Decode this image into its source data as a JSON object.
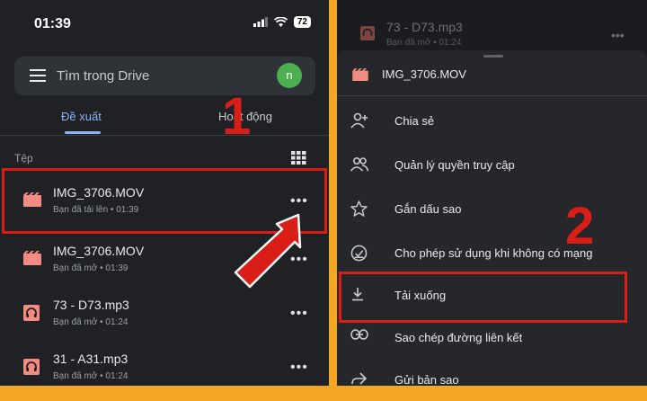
{
  "status_bar": {
    "time": "01:39",
    "battery": "72"
  },
  "search": {
    "placeholder": "Tìm trong Drive",
    "avatar_letter": "n"
  },
  "tabs": [
    {
      "label": "Đề xuất"
    },
    {
      "label": "Hoạt động"
    }
  ],
  "section_label": "Tệp",
  "files": [
    {
      "name": "IMG_3706.MOV",
      "meta": "Bạn đã tải lên • 01:39",
      "icon": "video-icon"
    },
    {
      "name": "IMG_3706.MOV",
      "meta": "Bạn đã mở • 01:39",
      "icon": "video-icon"
    },
    {
      "name": "73 - D73.mp3",
      "meta": "Bạn đã mở • 01:24",
      "icon": "audio-icon"
    },
    {
      "name": "31 - A31.mp3",
      "meta": "Bạn đã mở • 01:24",
      "icon": "audio-icon"
    }
  ],
  "right_top_file": {
    "name": "73 - D73.mp3",
    "meta": "Bạn đã mở • 01:24"
  },
  "sheet": {
    "title": "IMG_3706.MOV",
    "items": [
      {
        "label": "Chia sẻ",
        "icon": "person-add-icon"
      },
      {
        "label": "Quản lý quyền truy cập",
        "icon": "people-icon"
      },
      {
        "label": "Gắn dấu sao",
        "icon": "star-icon"
      },
      {
        "label": "Cho phép sử dụng khi không có mạng",
        "icon": "offline-icon"
      },
      {
        "label": "Tải xuống",
        "icon": "download-icon"
      },
      {
        "label": "Sao chép đường liên kết",
        "icon": "link-icon"
      },
      {
        "label": "Gửi bản sao",
        "icon": "share-icon"
      }
    ]
  },
  "annotations": {
    "step1": "1",
    "step2": "2"
  },
  "colors": {
    "accent": "#8ab4f8",
    "annotation_red": "#d91e18",
    "frame_orange": "#f5a623",
    "file_icon": "#f28b82"
  }
}
